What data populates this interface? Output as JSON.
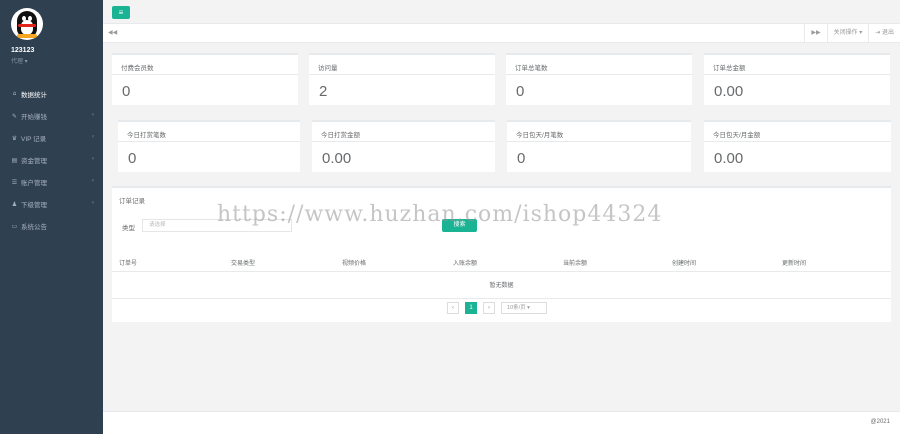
{
  "sidebar": {
    "username": "123123",
    "role": "代理 ▾",
    "items": [
      {
        "icon": "home-icon",
        "glyph": "⌂",
        "label": "数据统计",
        "arrow": ""
      },
      {
        "icon": "edit-icon",
        "glyph": "✎",
        "label": "开始赚钱",
        "arrow": "‹"
      },
      {
        "icon": "vip-icon",
        "glyph": "♛",
        "label": "VIP 记录",
        "arrow": "‹"
      },
      {
        "icon": "wallet-icon",
        "glyph": "▤",
        "label": "资金管理",
        "arrow": "‹"
      },
      {
        "icon": "user-icon",
        "glyph": "☰",
        "label": "账户管理",
        "arrow": "‹"
      },
      {
        "icon": "team-icon",
        "glyph": "♟",
        "label": "下级管理",
        "arrow": "‹"
      },
      {
        "icon": "notice-icon",
        "glyph": "▭",
        "label": "系统公告",
        "arrow": ""
      }
    ]
  },
  "topbar": {
    "menu_glyph": "≡"
  },
  "tabbar": {
    "left_glyph": "◀◀",
    "forward_glyph": "▶▶",
    "close_ops": "关闭操作 ▾",
    "logout": "⇥ 退出"
  },
  "stats_row1": [
    {
      "title": "付费会员数",
      "value": "0"
    },
    {
      "title": "访问量",
      "value": "2"
    },
    {
      "title": "订单总笔数",
      "value": "0"
    },
    {
      "title": "订单总金额",
      "value": "0.00"
    }
  ],
  "stats_row2": [
    {
      "title": "今日打赏笔数",
      "value": "0"
    },
    {
      "title": "今日打赏金额",
      "value": "0.00"
    },
    {
      "title": "今日包天/月笔数",
      "value": "0"
    },
    {
      "title": "今日包天/月金额",
      "value": "0.00"
    }
  ],
  "orders": {
    "title": "订单记录",
    "filter_label": "类型",
    "filter_placeholder": "请选择",
    "search_label": "搜索",
    "columns": [
      "订单号",
      "交易类型",
      "视频价格",
      "入账余额",
      "当前余额",
      "创建时间",
      "更新时间"
    ],
    "empty": "暂无数据",
    "pagination": {
      "prev": "‹",
      "current": "1",
      "next": "›",
      "page_size": "10条/页 ▾"
    }
  },
  "footer": {
    "text": "@2021"
  },
  "watermark": "https://www.huzhan.com/ishop44324"
}
